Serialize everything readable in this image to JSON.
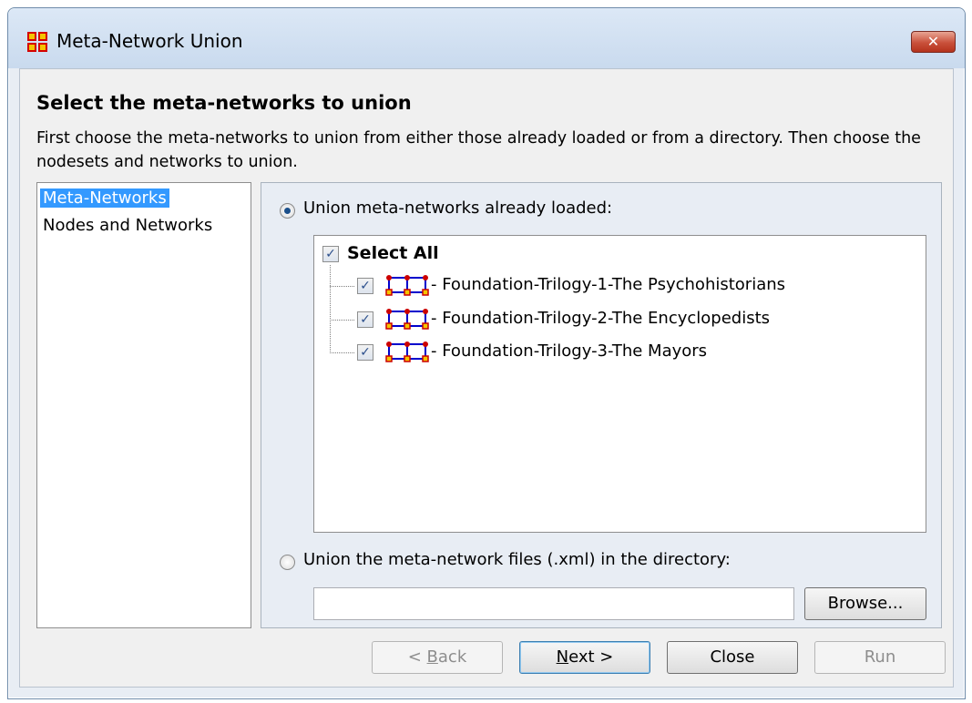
{
  "window": {
    "title": "Meta-Network Union",
    "close_glyph": "✕"
  },
  "page": {
    "heading": "Select the meta-networks to union",
    "description": "First choose the meta-networks to union from either those already loaded or from a directory. Then choose the nodesets and networks to union."
  },
  "nav": {
    "items": [
      {
        "label": "Meta-Networks",
        "selected": true
      },
      {
        "label": "Nodes and Networks",
        "selected": false
      }
    ]
  },
  "options": {
    "loaded_label": "Union meta-networks already loaded:",
    "loaded_selected": true,
    "directory_label": "Union the meta-network files (.xml) in the directory:",
    "directory_selected": false,
    "directory_value": ""
  },
  "tree": {
    "select_all_label": "Select All",
    "select_all_checked": true,
    "items": [
      {
        "label": "- Foundation-Trilogy-1-The Psychohistorians",
        "checked": true,
        "icon": "meta-network-icon"
      },
      {
        "label": "- Foundation-Trilogy-2-The Encyclopedists",
        "checked": true,
        "icon": "meta-network-icon"
      },
      {
        "label": "- Foundation-Trilogy-3-The Mayors",
        "checked": true,
        "icon": "meta-network-icon"
      }
    ]
  },
  "buttons": {
    "browse": "Browse...",
    "back_prefix": "< ",
    "back_mnemonic": "B",
    "back_rest": "ack",
    "next_mnemonic": "N",
    "next_rest": "ext >",
    "close": "Close",
    "run": "Run"
  },
  "colors": {
    "selection": "#3399ff",
    "title_bar": "#c9daee",
    "close_button": "#c9503a"
  }
}
